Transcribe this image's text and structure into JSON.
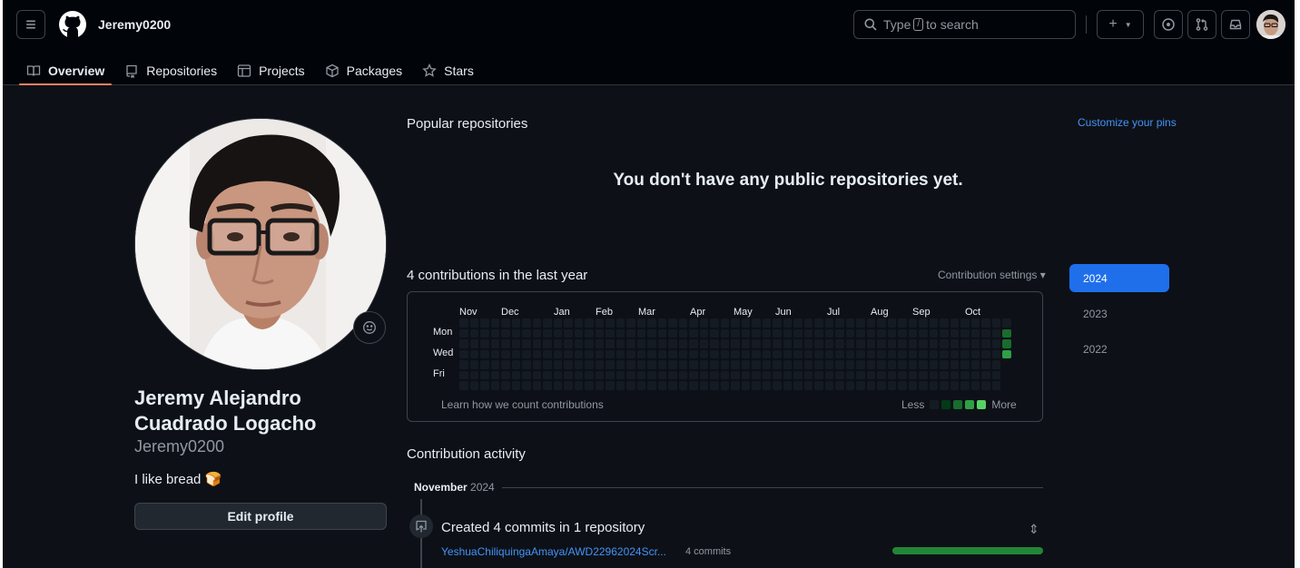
{
  "header": {
    "username": "Jeremy0200",
    "search": {
      "prefix": "Type",
      "key": "/",
      "suffix": "to search"
    },
    "plus_label": "+",
    "tabs": [
      {
        "label": "Overview",
        "icon": "book-icon",
        "active": true
      },
      {
        "label": "Repositories",
        "icon": "repo-icon"
      },
      {
        "label": "Projects",
        "icon": "table-icon"
      },
      {
        "label": "Packages",
        "icon": "package-icon"
      },
      {
        "label": "Stars",
        "icon": "star-icon"
      }
    ]
  },
  "profile": {
    "full_name": "Jeremy Alejandro Cuadrado Logacho",
    "login": "Jeremy0200",
    "bio": "I like bread",
    "bio_emoji": "🍞",
    "edit_label": "Edit profile"
  },
  "popular": {
    "title": "Popular repositories",
    "customize": "Customize your pins",
    "empty": "You don't have any public repositories yet."
  },
  "contributions": {
    "title": "4 contributions in the last year",
    "settings": "Contribution settings ▾",
    "months": [
      "Nov",
      "Dec",
      "Jan",
      "Feb",
      "Mar",
      "Apr",
      "May",
      "Jun",
      "Jul",
      "Aug",
      "Sep",
      "Oct"
    ],
    "days": [
      "Mon",
      "Wed",
      "Fri"
    ],
    "learn": "Learn how we count contributions",
    "less": "Less",
    "more": "More",
    "colors": [
      "#151b23",
      "#033a16",
      "#196c2e",
      "#2ea043",
      "#56d364"
    ],
    "weeks": 53,
    "active_cells": [
      {
        "week": 52,
        "day": 1,
        "level": 2
      },
      {
        "week": 52,
        "day": 2,
        "level": 2
      },
      {
        "week": 52,
        "day": 3,
        "level": 3
      }
    ]
  },
  "years": [
    "2024",
    "2023",
    "2022"
  ],
  "activity": {
    "title": "Contribution activity",
    "month": "November",
    "year": "2024",
    "event": "Created 4 commits in 1 repository",
    "repo": "YeshuaChiliquingaAmaya/AWD22962024Scr...",
    "commits": "4 commits",
    "bar_fraction": 1.0
  }
}
